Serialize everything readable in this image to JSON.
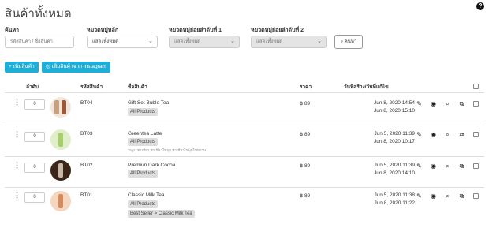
{
  "page": {
    "title": "สินค้าทั้งหมด",
    "help": "?"
  },
  "filters": {
    "search_label": "ค้นหา",
    "search_placeholder": "รหัสสินค้า / ชื่อสินค้า",
    "main_category_label": "หมวดหมู่หลัก",
    "main_category_value": "แสดงทั้งหมด",
    "sub1_label": "หมวดหมู่ย่อยลำดับที่ 1",
    "sub1_value": "แสดงทั้งหมด",
    "sub2_label": "หมวดหมู่ย่อยลำดับที่ 2",
    "sub2_value": "แสดงทั้งหมด",
    "search_button": "ค้นหา"
  },
  "actions": {
    "add_product": "เพิ่มสินค้า",
    "add_from_instagram": "เพิ่มสินค้าจาก Instagram"
  },
  "table": {
    "headers": {
      "order": "ลำดับ",
      "code": "รหัสสินค้า",
      "name": "ชื่อสินค้า",
      "price": "ราคา",
      "dates": "วันที่สร้าง/วันที่แก้ไข"
    },
    "rows": [
      {
        "order": "0",
        "code": "BT04",
        "name": "Gift Set Buble Tea",
        "categories": [
          "All Products"
        ],
        "tags": "",
        "price": "฿ 89",
        "created": "Jun 8, 2020 14:54",
        "updated": "Jun 8, 2020 15:10"
      },
      {
        "order": "0",
        "code": "BT03",
        "name": "Greentea Latte",
        "categories": [
          "All Products"
        ],
        "tags": "Tags: ชาเขียว,ชาเขียวไข่มุก,ชาเขียวไข่มุกไข่หวาน",
        "price": "฿ 89",
        "created": "Jun 5, 2020 11:39",
        "updated": "Jun 8, 2020 10:17"
      },
      {
        "order": "0",
        "code": "BT02",
        "name": "Premiun Dark Cocoa",
        "categories": [
          "All Products"
        ],
        "tags": "",
        "price": "฿ 89",
        "created": "Jun 5, 2020 11:39",
        "updated": "Jun 8, 2020 14:10"
      },
      {
        "order": "0",
        "code": "BT01",
        "name": "Classic Milk Tea",
        "categories": [
          "All Products",
          "Best Seller > Classic Milk Tea"
        ],
        "tags": "",
        "price": "฿ 89",
        "created": "Jun 5, 2020 11:38",
        "updated": "Jun 8, 2020 11:22"
      }
    ]
  },
  "colors": {
    "accent": "#1faed6"
  },
  "icons": {
    "edit": "edit-icon",
    "view": "eye-icon",
    "search": "search-icon",
    "copy": "copy-icon"
  }
}
